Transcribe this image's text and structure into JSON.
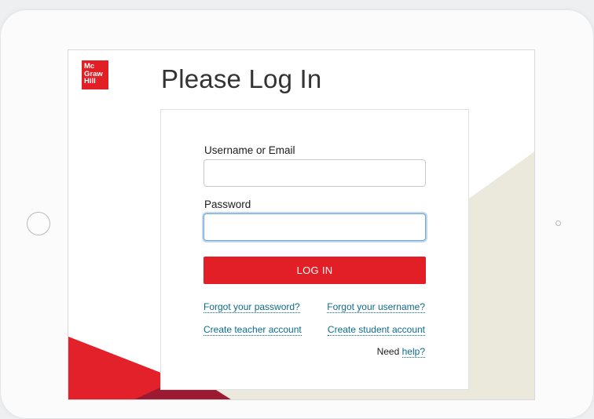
{
  "brand": {
    "logo_line1": "Mc",
    "logo_line2": "Graw",
    "logo_line3": "Hill",
    "color": "#e31f26"
  },
  "page": {
    "title": "Please Log In"
  },
  "login_form": {
    "username_label": "Username or Email",
    "username_value": "",
    "password_label": "Password",
    "password_value": "",
    "submit_label": "LOG IN"
  },
  "links": {
    "forgot_password": "Forgot your password?",
    "forgot_username": "Forgot your username?",
    "create_teacher": "Create teacher account",
    "create_student": "Create student account",
    "need_text": "Need",
    "help": "help?"
  },
  "colors": {
    "accent_red": "#e21f26",
    "link_blue": "#0e6b8d",
    "bg_beige": "#ebe8dc",
    "dark_red": "#9e1b32"
  }
}
